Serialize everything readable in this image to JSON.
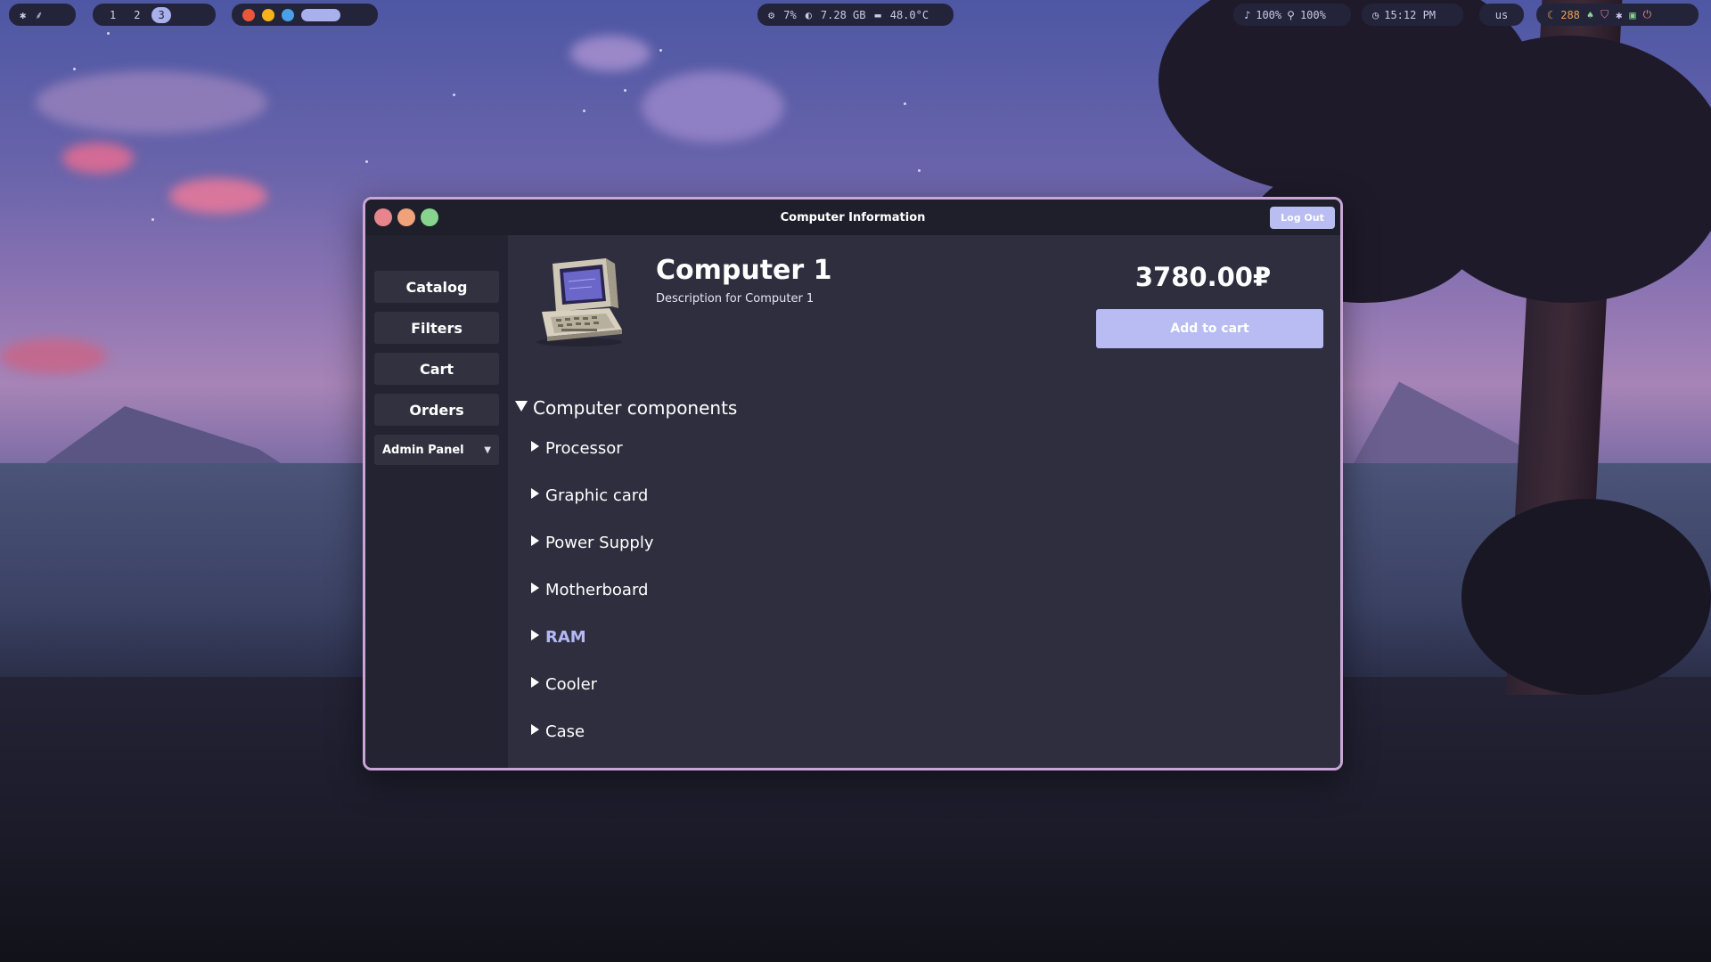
{
  "topbar": {
    "workspaces": [
      "1",
      "2",
      "3"
    ],
    "active_workspace": "3",
    "cpu": "7%",
    "memory": "7.28 GB",
    "temperature": "48.0°C",
    "volume": "100%",
    "mic": "100%",
    "clock": "15:12 PM",
    "keyboard_layout": "us",
    "updates": "288"
  },
  "window": {
    "title": "Computer Information",
    "logout_label": "Log Out"
  },
  "sidebar": {
    "items": [
      {
        "label": "Catalog"
      },
      {
        "label": "Filters"
      },
      {
        "label": "Cart"
      },
      {
        "label": "Orders"
      }
    ],
    "admin_select": "Admin Panel"
  },
  "product": {
    "name": "Computer 1",
    "description": "Description for Computer 1",
    "price": "3780.00₽",
    "add_to_cart_label": "Add to cart",
    "image_icon": "retro-computer-icon"
  },
  "components": {
    "title": "Computer components",
    "expanded": true,
    "items": [
      {
        "label": "Processor"
      },
      {
        "label": "Graphic card"
      },
      {
        "label": "Power Supply"
      },
      {
        "label": "Motherboard"
      },
      {
        "label": "RAM"
      },
      {
        "label": "Cooler"
      },
      {
        "label": "Case"
      }
    ],
    "highlighted_item": "RAM"
  },
  "colors": {
    "accent": "#b8bcf2",
    "window_border": "#c9a5d8",
    "close": "#e8848c",
    "minimize": "#f0a27a",
    "maximize": "#86d48e"
  }
}
